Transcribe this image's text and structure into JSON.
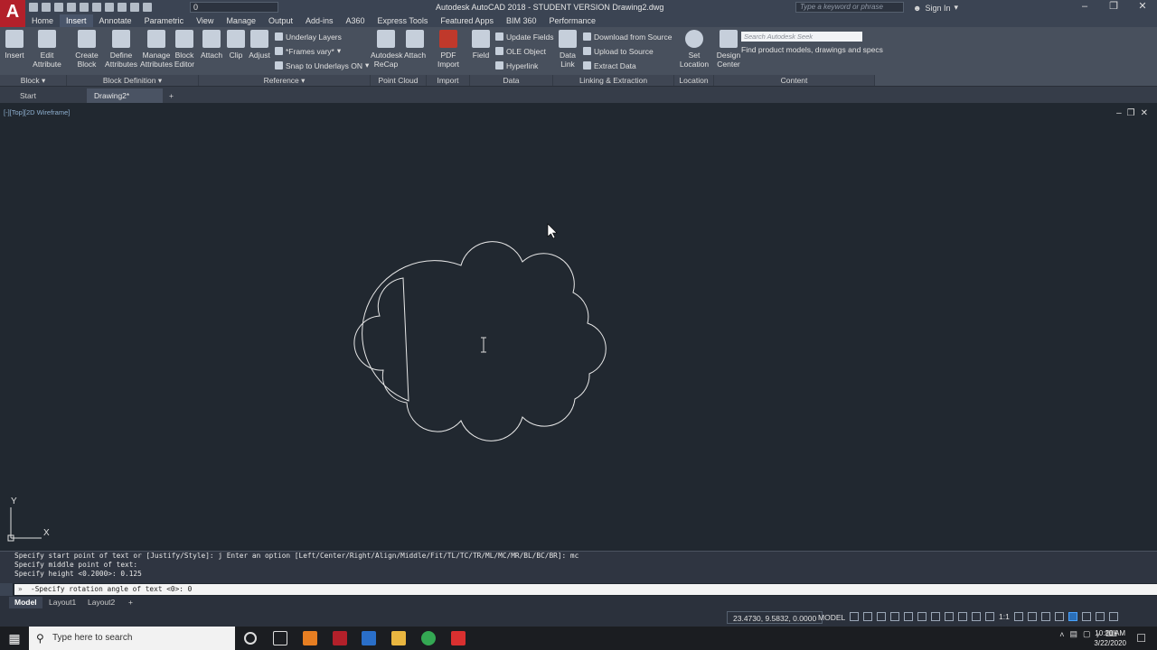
{
  "app": {
    "logo_letter": "A",
    "window_title": "Autodesk AutoCAD 2018 - STUDENT VERSION   Drawing2.dwg",
    "workspace_value": "0",
    "search_placeholder": "Type a keyword or phrase",
    "sign_in_label": "Sign In"
  },
  "menu_tabs": [
    "Home",
    "Insert",
    "Annotate",
    "Parametric",
    "View",
    "Manage",
    "Output",
    "Add-ins",
    "A360",
    "Express Tools",
    "Featured Apps",
    "BIM 360",
    "Performance"
  ],
  "active_menu_tab": "Insert",
  "ribbon": {
    "buttons": {
      "insert": "Insert",
      "edit_attribute": "Edit\nAttribute",
      "create_block": "Create\nBlock",
      "define_attributes": "Define\nAttributes",
      "manage_attributes": "Manage\nAttributes",
      "block_editor": "Block\nEditor",
      "attach": "Attach",
      "clip": "Clip",
      "adjust": "Adjust",
      "autodesk_recap": "Autodesk\nReCap",
      "attach_pc": "Attach",
      "pdf_import": "PDF\nImport",
      "field": "Field",
      "data_link": "Data\nLink",
      "set_location": "Set\nLocation",
      "design_center": "Design\nCenter"
    },
    "small": {
      "underlay_layers": "Underlay Layers",
      "frames_vary": "*Frames vary*",
      "snap_underlays": "Snap to Underlays ON",
      "update_fields": "Update Fields",
      "ole_object": "OLE Object",
      "hyperlink": "Hyperlink",
      "download_from_source": "Download from Source",
      "upload_to_source": "Upload to Source",
      "extract_data": "Extract  Data"
    },
    "seek_placeholder": "Search Autodesk Seek",
    "seek_description": "Find product models, drawings and specs",
    "panels": {
      "block": "Block",
      "block_definition": "Block Definition",
      "reference": "Reference",
      "point_cloud": "Point Cloud",
      "import": "Import",
      "data": "Data",
      "linking": "Linking & Extraction",
      "location": "Location",
      "content": "Content"
    }
  },
  "doc_tabs": {
    "start": "Start",
    "drawing": "Drawing2*",
    "new": "+"
  },
  "viewport": {
    "label": "[-][Top][2D Wireframe]",
    "axis_y": "Y",
    "axis_x": "X"
  },
  "command": {
    "history": [
      "Specify start point of text or [Justify/Style]: j Enter an option [Left/Center/Right/Align/Middle/Fit/TL/TC/TR/ML/MC/MR/BL/BC/BR]: mc",
      "Specify middle point of text:",
      "Specify height <0.2000>: 0.125"
    ],
    "current": "-Specify rotation angle of text <0>: 0"
  },
  "layout_tabs": {
    "model": "Model",
    "layout1": "Layout1",
    "layout2": "Layout2",
    "add": "+"
  },
  "status": {
    "coords": "23.4730, 9.5832, 0.0000",
    "model": "MODEL",
    "scale": "1:1"
  },
  "taskbar": {
    "search_placeholder": "Type here to search",
    "time": "10:20 AM",
    "date": "3/22/2020"
  },
  "colors": {
    "accent_red": "#b3202a",
    "canvas": "#212830",
    "ribbon": "#48505d"
  }
}
